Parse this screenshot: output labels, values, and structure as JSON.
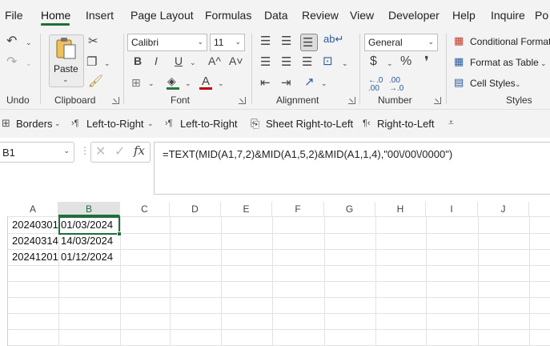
{
  "menu": {
    "tabs": [
      "File",
      "Home",
      "Insert",
      "Page Layout",
      "Formulas",
      "Data",
      "Review",
      "View",
      "Developer",
      "Help",
      "Inquire",
      "Po"
    ],
    "active": "Home"
  },
  "ribbon": {
    "groups": {
      "undo": "Undo",
      "clipboard": "Clipboard",
      "font": "Font",
      "alignment": "Alignment",
      "number": "Number",
      "styles": "Styles"
    },
    "paste_label": "Paste",
    "font_name": "Calibri",
    "font_size": "11",
    "bold": "B",
    "italic": "I",
    "underline": "U",
    "grow_font": "A^",
    "shrink_font": "A˅",
    "font_color_glyph": "A",
    "number_format": "General",
    "currency": "$",
    "percent": "%",
    "comma": "❜",
    "conditional_formatting": "Conditional Formatting",
    "format_as_table": "Format as Table",
    "cell_styles": "Cell Styles"
  },
  "quick_access": {
    "borders": "Borders",
    "left_to_right_1": "Left-to-Right",
    "left_to_right_2": "Left-to-Right",
    "sheet_rtl": "Sheet Right-to-Left",
    "right_to_left": "Right-to-Left"
  },
  "formula_bar": {
    "name_box": "B1",
    "fx": "fx",
    "formula": "=TEXT(MID(A1,7,2)&MID(A1,5,2)&MID(A1,1,4),\"00\\/00\\/0000\")"
  },
  "sheet": {
    "columns": [
      "A",
      "B",
      "C",
      "D",
      "E",
      "F",
      "G",
      "H",
      "I",
      "J"
    ],
    "selected_column": "B",
    "rows": [
      {
        "a": "20240301",
        "b": "01/03/2024"
      },
      {
        "a": "20240314",
        "b": "14/03/2024"
      },
      {
        "a": "20241201",
        "b": "01/12/2024"
      }
    ],
    "colors": {
      "accent": "#1e6f3a",
      "font_color_bar": "#c00000",
      "fill_color_bar": "#1e7a3a"
    }
  }
}
